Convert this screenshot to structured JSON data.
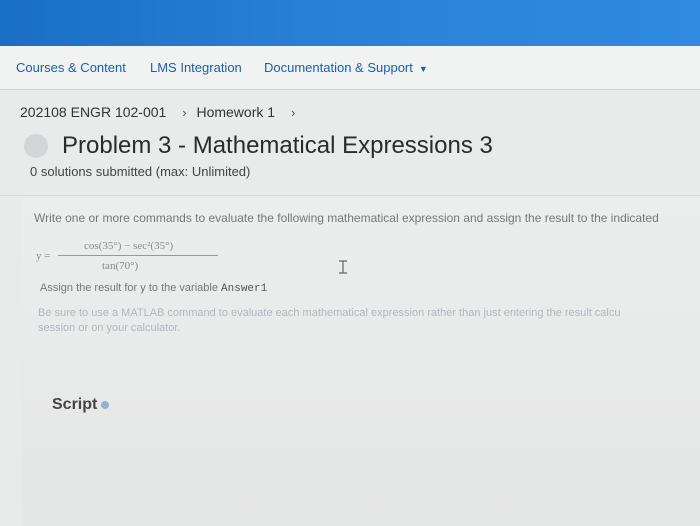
{
  "nav": {
    "courses": "Courses & Content",
    "lms": "LMS Integration",
    "docs": "Documentation & Support"
  },
  "breadcrumb": {
    "course": "202108 ENGR 102-001",
    "homework": "Homework 1"
  },
  "problem": {
    "title": "Problem 3 - Mathematical Expressions 3",
    "solutions": "0 solutions submitted (max: Unlimited)"
  },
  "content": {
    "instruction": "Write one or more commands to evaluate the following mathematical expression and assign the result to the indicated",
    "equation": {
      "lhs": "y =",
      "numerator": "cos(35°) − sec²(35°)",
      "denominator": "tan(70°)"
    },
    "assign_prefix": "Assign the result for",
    "assign_var": "y",
    "assign_mid": "to the variable",
    "assign_name": "Answer1",
    "note_line1": "Be sure to use a MATLAB command to evaluate each mathematical expression rather than just entering the result calcu",
    "note_line2": "session or on your calculator."
  },
  "script": {
    "label": "Script"
  }
}
